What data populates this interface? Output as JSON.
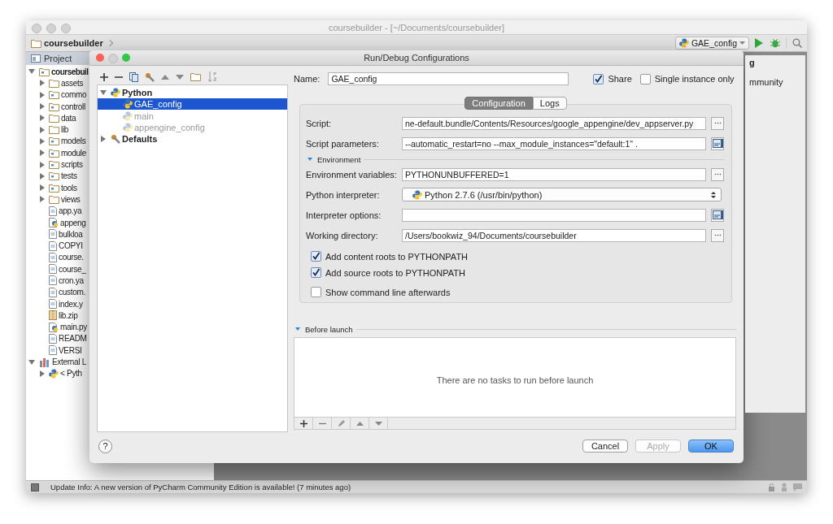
{
  "ide": {
    "title": "coursebuilder - [~/Documents/coursebuilder]",
    "breadcrumb": "coursebuilder",
    "run_config": "GAE_config",
    "tool_window": "Project",
    "tree": [
      {
        "label": "coursebuil",
        "kind": "module",
        "expanded": true,
        "children": [
          {
            "label": "assets",
            "kind": "folder",
            "expanded": false
          },
          {
            "label": "commo",
            "kind": "package",
            "expanded": false
          },
          {
            "label": "controll",
            "kind": "package",
            "expanded": false
          },
          {
            "label": "data",
            "kind": "folder",
            "expanded": false
          },
          {
            "label": "lib",
            "kind": "folder",
            "expanded": false
          },
          {
            "label": "models",
            "kind": "package",
            "expanded": false
          },
          {
            "label": "module",
            "kind": "package",
            "expanded": false
          },
          {
            "label": "scripts",
            "kind": "package",
            "expanded": false
          },
          {
            "label": "tests",
            "kind": "package",
            "expanded": false
          },
          {
            "label": "tools",
            "kind": "package",
            "expanded": false
          },
          {
            "label": "views",
            "kind": "folder",
            "expanded": false
          },
          {
            "label": "app.ya",
            "kind": "file"
          },
          {
            "label": "appeng",
            "kind": "python-file"
          },
          {
            "label": "bulkloa",
            "kind": "file"
          },
          {
            "label": "COPYI",
            "kind": "file"
          },
          {
            "label": "course.",
            "kind": "file"
          },
          {
            "label": "course_",
            "kind": "file"
          },
          {
            "label": "cron.ya",
            "kind": "file"
          },
          {
            "label": "custom.",
            "kind": "file"
          },
          {
            "label": "index.y",
            "kind": "file"
          },
          {
            "label": "lib.zip",
            "kind": "archive"
          },
          {
            "label": "main.py",
            "kind": "python-file"
          },
          {
            "label": "READM",
            "kind": "file"
          },
          {
            "label": "VERSI",
            "kind": "file"
          }
        ]
      },
      {
        "label": "External L",
        "kind": "library",
        "expanded": true,
        "children": [
          {
            "label": "< Pyth",
            "kind": "python-sdk",
            "expanded": false
          }
        ]
      }
    ],
    "side_panel": {
      "heading": "g",
      "text": "mmunity"
    },
    "status_bar": "Update Info: A new version of PyCharm Community Edition is available! (7 minutes ago)"
  },
  "dialog": {
    "title": "Run/Debug Configurations",
    "tree": [
      {
        "label": "Python",
        "kind": "group",
        "expanded": true,
        "children": [
          {
            "label": "GAE_config",
            "kind": "config",
            "selected": true,
            "temporary": false
          },
          {
            "label": "main",
            "kind": "config",
            "selected": false,
            "temporary": true
          },
          {
            "label": "appengine_config",
            "kind": "config",
            "selected": false,
            "temporary": true
          }
        ]
      },
      {
        "label": "Defaults",
        "kind": "defaults",
        "expanded": false
      }
    ],
    "name": {
      "label": "Name:",
      "value": "GAE_config"
    },
    "share": {
      "label": "Share",
      "checked": true
    },
    "single_instance": {
      "label": "Single instance only",
      "checked": false
    },
    "tabs": [
      {
        "label": "Configuration",
        "selected": true
      },
      {
        "label": "Logs",
        "selected": false
      }
    ],
    "fields": [
      {
        "label": "Script:",
        "value": "ne-default.bundle/Contents/Resources/google_appengine/dev_appserver.py",
        "kind": "text",
        "trailing": {
          "kind": "browse"
        }
      },
      {
        "label": "Script parameters:",
        "value": "--automatic_restart=no --max_module_instances=\"default:1\" .",
        "kind": "text",
        "trailing": {
          "kind": "expand"
        }
      }
    ],
    "environment": {
      "label": "Environment",
      "expanded": true
    },
    "env_fields": [
      {
        "label": "Environment variables:",
        "value": "PYTHONUNBUFFERED=1",
        "kind": "text",
        "trailing": {
          "kind": "browse"
        }
      },
      {
        "label": "Python interpreter:",
        "value": "Python 2.7.6 (/usr/bin/python)",
        "kind": "select"
      },
      {
        "label": "Interpreter options:",
        "kind": "text",
        "trailing": {
          "kind": "expand"
        }
      },
      {
        "label": "Working directory:",
        "value": "/Users/bookwiz_94/Documents/coursebuilder",
        "kind": "text",
        "trailing": {
          "kind": "browse"
        }
      }
    ],
    "checkboxes": [
      {
        "label": "Add content roots to PYTHONPATH",
        "checked": true
      },
      {
        "label": "Add source roots to PYTHONPATH",
        "checked": true
      },
      {
        "label": "Show command line afterwards",
        "checked": false
      }
    ],
    "before_launch": {
      "label": "Before launch",
      "expanded": true,
      "empty_text": "There are no tasks to run before launch"
    },
    "help": "?",
    "buttons": [
      {
        "label": "Cancel",
        "kind": "normal"
      },
      {
        "label": "Apply",
        "kind": "disabled"
      },
      {
        "label": "OK",
        "kind": "default"
      }
    ]
  }
}
